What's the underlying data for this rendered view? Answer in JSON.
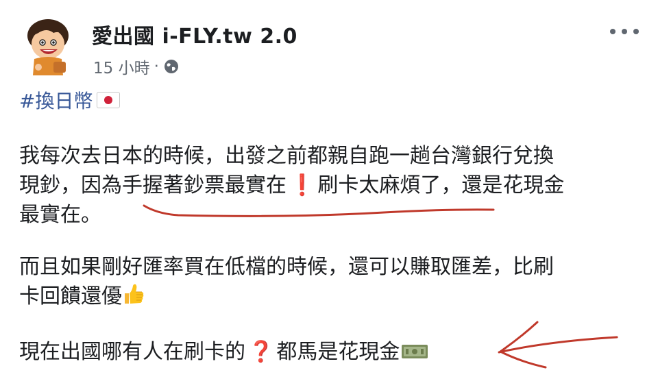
{
  "post": {
    "author": "愛出國 i-FLY.tw 2.0",
    "time": "15 小時",
    "separator": "·",
    "privacy_icon": "globe-icon",
    "more_icon": "more-horizontal-icon",
    "hashtag": "#換日幣",
    "hashtag_icon": "flag-jp-icon",
    "paragraph1": {
      "line1": "我每次去日本的時候，出發之前都親自跑一趟台灣銀行兌換",
      "line2_a": "現鈔，因為手握著鈔票最實在",
      "line2_b": "刷卡太麻煩了，還是花現金",
      "line3": "最實在。"
    },
    "paragraph2": {
      "line1": "而且如果剛好匯率買在低檔的時候，還可以賺取匯差，比刷",
      "line2": "卡回饋還優"
    },
    "paragraph3": {
      "text_a": "現在出國哪有人在刷卡的",
      "text_b": "都馬是花現金"
    },
    "emoji": {
      "exclamation": "❗",
      "question": "❓",
      "thumbs_up": "thumbs-up-icon",
      "money": "money-icon"
    },
    "annotation_color": "#c0392b",
    "link_color": "#385898"
  }
}
